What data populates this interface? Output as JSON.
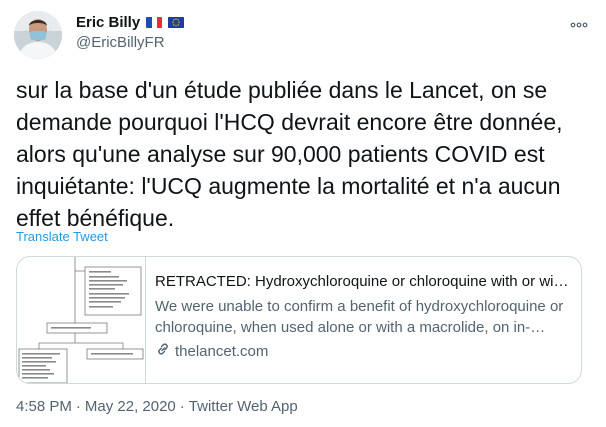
{
  "author": {
    "display_name": "Eric Billy",
    "handle": "@EricBillyFR",
    "flags": [
      "french-flag-icon",
      "eu-flag-icon"
    ]
  },
  "tweet": {
    "text": "sur la base d'un étude publiée dans le Lancet, on se\ndemande pourquoi l'HCQ devrait encore être donnée,\nalors qu'une analyse sur 90,000 patients COVID est\ninquiétante: l'UCQ augmente la mortalité et n'a aucun\neffet bénéfique.",
    "translate_label": "Translate Tweet"
  },
  "card": {
    "title": "RETRACTED: Hydroxychloroquine or chloroquine with or wit…",
    "description": "We were unable to confirm a benefit of hydroxychloroquine or chloroquine, when used alone or with a macrolide, on in-…",
    "domain": "thelancet.com",
    "thumbnail_boxes": [
      "2238 excluded",
      "14 (02) patients included",
      "14 888 in treatment groups",
      "81 144 in control group"
    ]
  },
  "meta": {
    "time": "4:58 PM",
    "separator": "·",
    "date": "May 22, 2020",
    "source": "Twitter Web App"
  },
  "colors": {
    "accent": "#1d9bf0",
    "secondary_text": "#536471",
    "border": "#cfd9de"
  }
}
